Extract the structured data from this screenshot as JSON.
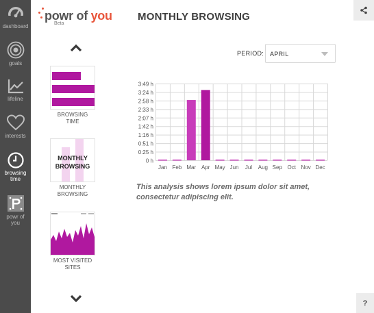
{
  "nav": {
    "items": [
      {
        "label_lines": [
          "dashboard"
        ],
        "icon": "gauge-icon"
      },
      {
        "label_lines": [
          "goals"
        ],
        "icon": "target-icon"
      },
      {
        "label_lines": [
          "lifeline"
        ],
        "icon": "line-chart-icon"
      },
      {
        "label_lines": [
          "interests"
        ],
        "icon": "heart-icon"
      },
      {
        "label_lines": [
          "browsing",
          "time"
        ],
        "icon": "clock-icon",
        "active": true
      },
      {
        "label_lines": [
          "powr of",
          "you"
        ],
        "icon": "powr-logo-icon"
      }
    ]
  },
  "logo": {
    "text_main": "powr of ",
    "text_accent": "you",
    "beta": "Beta"
  },
  "page_title": "MONTHLY BROWSING",
  "thumbnails": [
    {
      "caption_lines": [
        "BROWSING",
        "TIME"
      ]
    },
    {
      "caption_lines": [
        "MONTHLY",
        "BROWSING"
      ],
      "overlay_lines": [
        "MONTHLY",
        "BROWSING"
      ],
      "selected": true
    },
    {
      "caption_lines": [
        "MOST VISITED",
        "SITES"
      ]
    }
  ],
  "period": {
    "label": "PERIOD:",
    "value": "APRIL"
  },
  "chart_data": {
    "type": "bar",
    "categories": [
      "Jan",
      "Feb",
      "Mar",
      "Apr",
      "May",
      "Jun",
      "Jul",
      "Aug",
      "Sep",
      "Oct",
      "Nov",
      "Dec"
    ],
    "values": [
      0,
      0,
      3.0,
      3.5,
      0,
      0,
      0,
      0,
      0,
      0,
      0,
      0
    ],
    "y_ticks": [
      "0 h",
      "0:25 h",
      "0:51 h",
      "1:16 h",
      "1:42 h",
      "2:07 h",
      "2:33 h",
      "2:58 h",
      "3:24 h",
      "3:49 h"
    ],
    "ylim": [
      0,
      3.82
    ],
    "grid": true,
    "colors": {
      "highlight": "#b0189f",
      "normal": "#c83cba",
      "grid": "#d8d8d8"
    }
  },
  "description": "This analysis shows lorem ipsum dolor sit amet, consectetur adipiscing elit.",
  "help_label": "?"
}
